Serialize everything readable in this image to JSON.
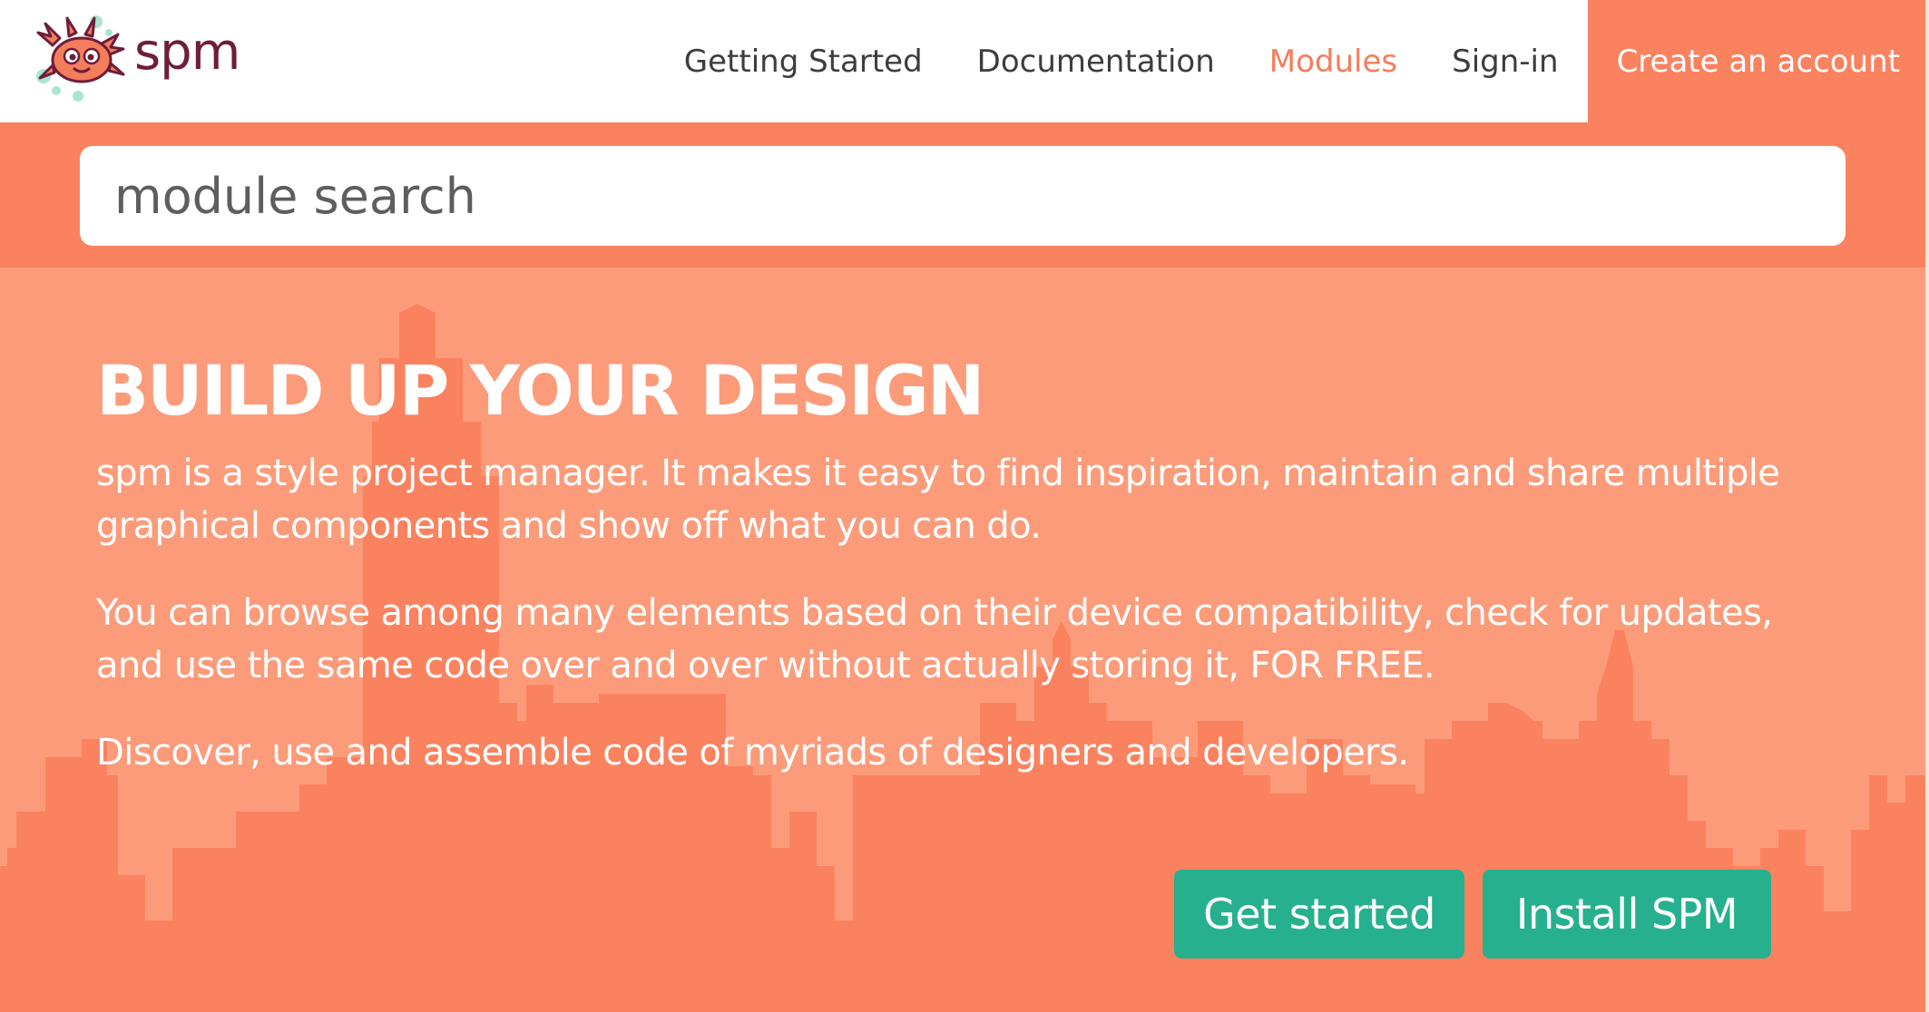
{
  "brand": {
    "name": "spm",
    "color": "#6e1d3a"
  },
  "nav": {
    "items": [
      {
        "label": "Getting Started",
        "active": false
      },
      {
        "label": "Documentation",
        "active": false
      },
      {
        "label": "Modules",
        "active": true
      },
      {
        "label": "Sign-in",
        "active": false
      }
    ],
    "cta_label": "Create an account"
  },
  "search": {
    "placeholder": "module search"
  },
  "hero": {
    "title": "BUILD UP YOUR DESIGN",
    "paragraphs": [
      "spm is a style project manager. It makes it easy to find inspiration, maintain and share multiple graphical components and show off what you can do.",
      "You can browse among many elements based on their device compatibility, check for updates, and use the same code over and over without actually storing it, FOR FREE.",
      "Discover, use and assemble code of myriads of designers and developers."
    ],
    "buttons": {
      "get_started": "Get started",
      "install": "Install SPM"
    }
  },
  "colors": {
    "accent": "#fb825f",
    "hero_bg": "#fc9b7a",
    "skyline": "#fb825f",
    "button": "#27b08e",
    "active_nav": "#f47d5b"
  },
  "icons": {
    "logo": "spm-mascot-icon"
  }
}
